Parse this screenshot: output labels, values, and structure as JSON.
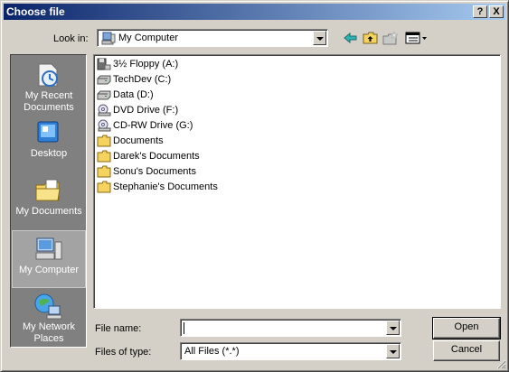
{
  "window": {
    "title": "Choose file",
    "help_label": "?",
    "close_label": "X"
  },
  "lookin": {
    "label": "Look in:",
    "value": "My Computer"
  },
  "places": [
    {
      "line1": "My Recent",
      "line2": "Documents"
    },
    {
      "line1": "Desktop",
      "line2": ""
    },
    {
      "line1": "My Documents",
      "line2": ""
    },
    {
      "line1": "My Computer",
      "line2": ""
    },
    {
      "line1": "My Network",
      "line2": "Places"
    }
  ],
  "files": [
    {
      "name": "3½ Floppy (A:)",
      "icon": "floppy-drive-icon"
    },
    {
      "name": "TechDev (C:)",
      "icon": "hard-drive-icon"
    },
    {
      "name": "Data (D:)",
      "icon": "hard-drive-icon"
    },
    {
      "name": "DVD Drive (F:)",
      "icon": "dvd-drive-icon"
    },
    {
      "name": "CD-RW Drive (G:)",
      "icon": "cd-drive-icon"
    },
    {
      "name": "Documents",
      "icon": "folder-icon"
    },
    {
      "name": "Darek's Documents",
      "icon": "folder-icon"
    },
    {
      "name": "Sonu's Documents",
      "icon": "folder-icon"
    },
    {
      "name": "Stephanie's Documents",
      "icon": "folder-icon"
    }
  ],
  "filename": {
    "label": "File name:",
    "value": ""
  },
  "filetype": {
    "label": "Files of type:",
    "value": "All Files (*.*)"
  },
  "buttons": {
    "open": "Open",
    "cancel": "Cancel"
  },
  "colors": {
    "titlebar_start": "#0a246a",
    "titlebar_end": "#a6caf0",
    "face": "#d4d0c8",
    "places_bg": "#808080",
    "folder": "#f4d35e"
  }
}
